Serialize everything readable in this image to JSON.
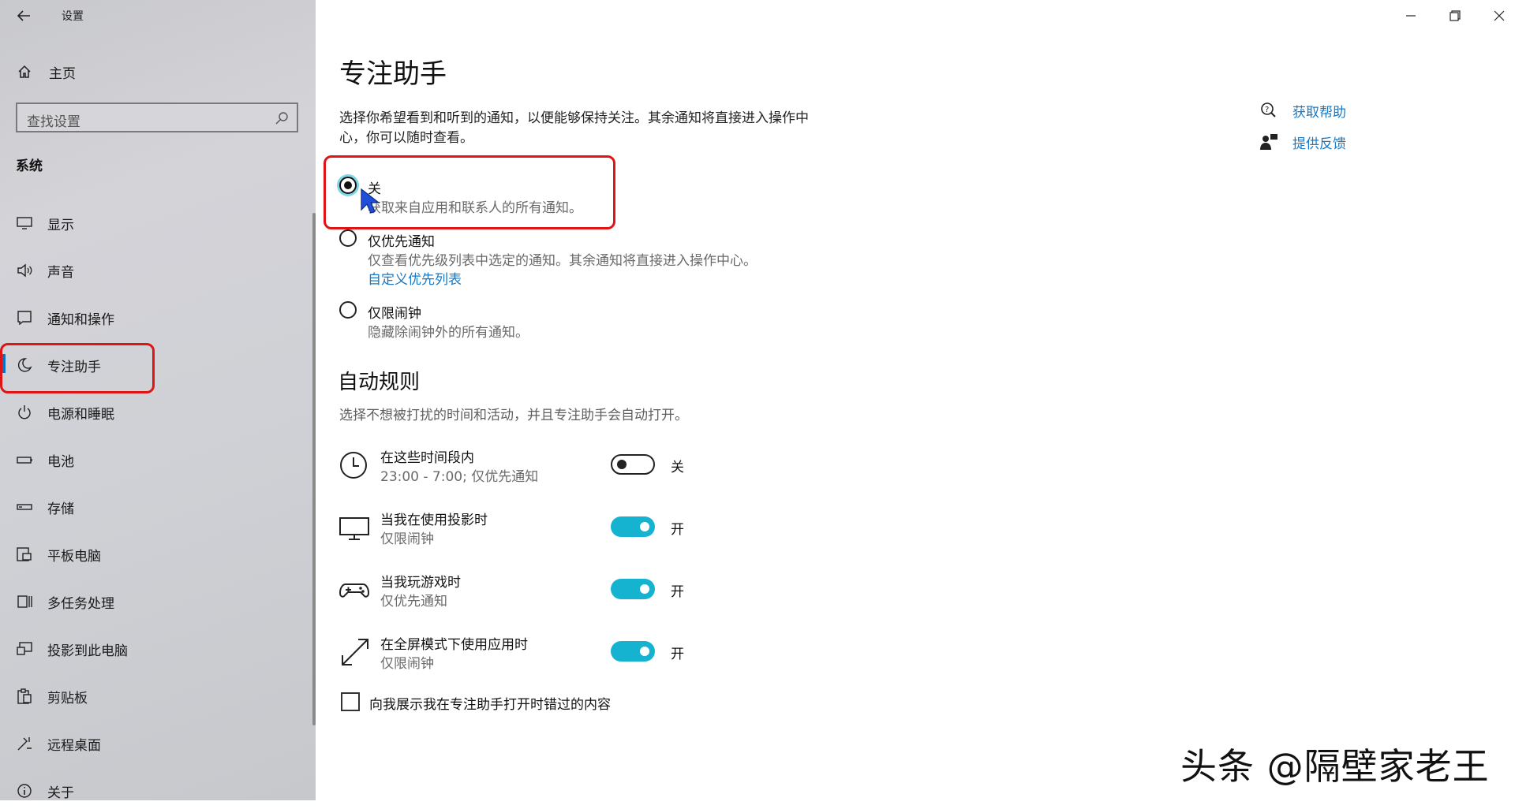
{
  "window": {
    "title": "设置",
    "minimize_icon": "minimize-icon",
    "restore_icon": "restore-icon",
    "close_icon": "close-icon"
  },
  "sidebar": {
    "home_label": "主页",
    "search_placeholder": "查找设置",
    "section": "系统",
    "items": [
      {
        "label": "显示",
        "icon": "monitor-icon"
      },
      {
        "label": "声音",
        "icon": "speaker-icon"
      },
      {
        "label": "通知和操作",
        "icon": "notification-icon"
      },
      {
        "label": "专注助手",
        "icon": "moon-icon",
        "active": true
      },
      {
        "label": "电源和睡眠",
        "icon": "power-icon"
      },
      {
        "label": "电池",
        "icon": "battery-icon"
      },
      {
        "label": "存储",
        "icon": "storage-icon"
      },
      {
        "label": "平板电脑",
        "icon": "tablet-icon"
      },
      {
        "label": "多任务处理",
        "icon": "multitask-icon"
      },
      {
        "label": "投影到此电脑",
        "icon": "project-icon"
      },
      {
        "label": "剪贴板",
        "icon": "clipboard-icon"
      },
      {
        "label": "远程桌面",
        "icon": "remote-desktop-icon"
      },
      {
        "label": "关于",
        "icon": "info-icon"
      }
    ]
  },
  "main": {
    "title": "专注助手",
    "intro": "选择你希望看到和听到的通知，以便能够保持关注。其余通知将直接进入操作中心，你可以随时查看。",
    "options": [
      {
        "title": "关",
        "desc": "获取来自应用和联系人的所有通知。",
        "selected": true
      },
      {
        "title": "仅优先通知",
        "desc": "仅查看优先级列表中选定的通知。其余通知将直接进入操作中心。",
        "link": "自定义优先列表",
        "selected": false
      },
      {
        "title": "仅限闹钟",
        "desc": "隐藏除闹钟外的所有通知。",
        "selected": false
      }
    ],
    "auto_rules": {
      "heading": "自动规则",
      "desc": "选择不想被打扰的时间和活动，并且专注助手会自动打开。",
      "rules": [
        {
          "title": "在这些时间段内",
          "sub": "23:00 - 7:00; 仅优先通知",
          "state": "关",
          "on": false,
          "icon": "clock-icon"
        },
        {
          "title": "当我在使用投影时",
          "sub": "仅限闹钟",
          "state": "开",
          "on": true,
          "icon": "display-icon"
        },
        {
          "title": "当我玩游戏时",
          "sub": "仅优先通知",
          "state": "开",
          "on": true,
          "icon": "gamepad-icon"
        },
        {
          "title": "在全屏模式下使用应用时",
          "sub": "仅限闹钟",
          "state": "开",
          "on": true,
          "icon": "fullscreen-icon"
        }
      ]
    },
    "checkbox_label": "向我展示我在专注助手打开时错过的内容",
    "help": {
      "get_help": "获取帮助",
      "feedback": "提供反馈"
    }
  },
  "watermark": "头条 @隔壁家老王",
  "colors": {
    "accent": "#16b3d0",
    "link": "#1a78c2",
    "highlight": "#e01414"
  }
}
